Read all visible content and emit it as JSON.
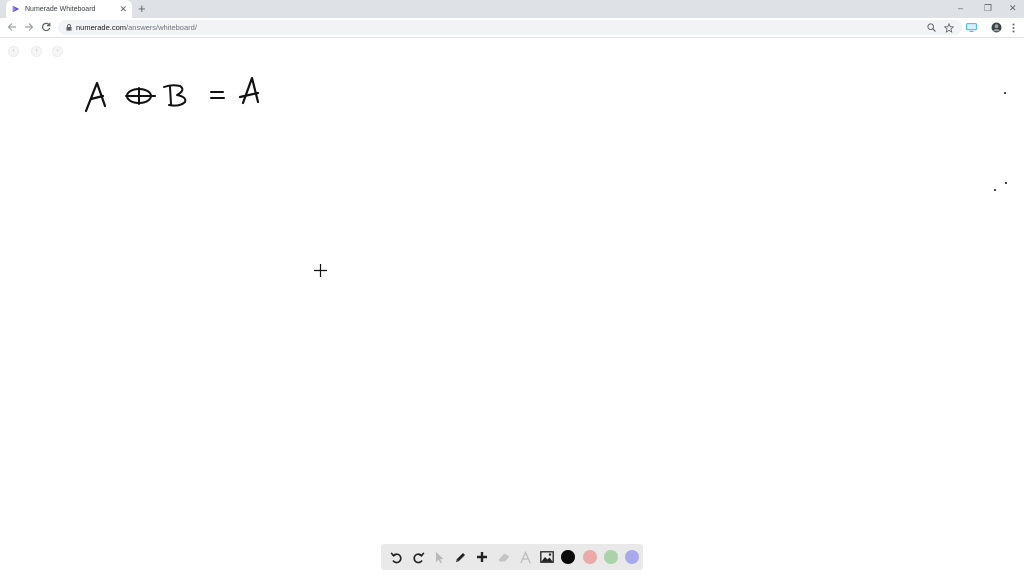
{
  "browser": {
    "tab": {
      "title": "Numerade Whiteboard",
      "favicon_icon": "numerade-logo-icon"
    },
    "url": {
      "host": "numerade.com",
      "path": "/answers/whiteboard/"
    },
    "window_controls": {
      "minimize": "–",
      "restore": "❐",
      "close": "✕"
    }
  },
  "whiteboard": {
    "page_nav": [
      "‹",
      "‹",
      "›"
    ],
    "expression": {
      "lhs_a": "A",
      "operator": "⊕",
      "lhs_b": "B",
      "equals": "=",
      "rhs": "A"
    }
  },
  "toolbar": {
    "tools": [
      {
        "name": "undo",
        "icon": "undo-icon"
      },
      {
        "name": "redo",
        "icon": "redo-icon"
      },
      {
        "name": "select",
        "icon": "pointer-icon",
        "disabled": true
      },
      {
        "name": "pen",
        "icon": "pencil-icon"
      },
      {
        "name": "add",
        "icon": "plus-icon"
      },
      {
        "name": "eraser",
        "icon": "eraser-icon",
        "disabled": true
      },
      {
        "name": "text",
        "icon": "text-icon",
        "disabled": true
      },
      {
        "name": "image",
        "icon": "image-icon"
      }
    ],
    "colors": [
      "#0a0a0a",
      "#eaaaa9",
      "#aad3a9",
      "#a9aaea"
    ]
  }
}
